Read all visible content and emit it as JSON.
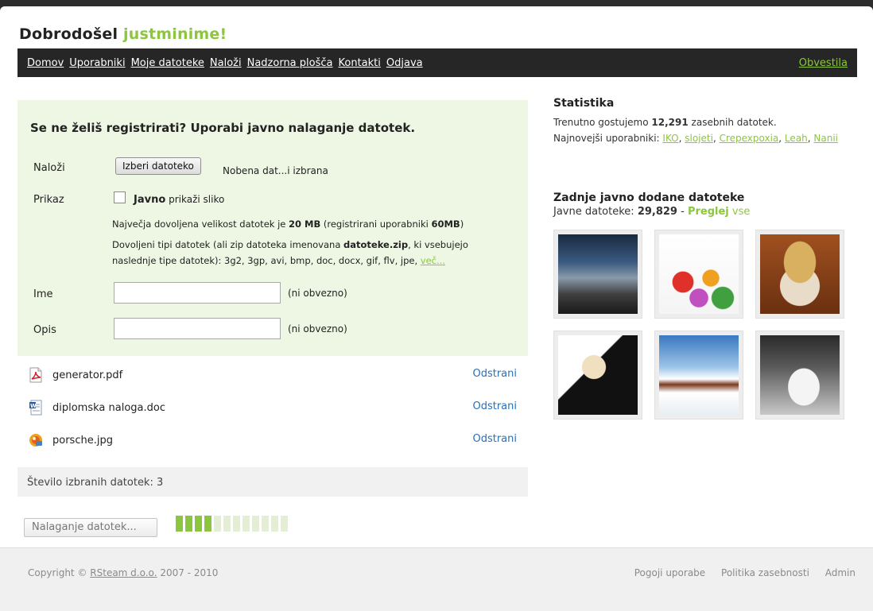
{
  "header": {
    "greeting": "Dobrodošel",
    "username": "justminime!"
  },
  "nav": {
    "items": [
      "Domov",
      "Uporabniki",
      "Moje datoteke",
      "Naloži",
      "Nadzorna plošča",
      "Kontakti",
      "Odjava"
    ],
    "right": "Obvestila"
  },
  "upload": {
    "heading": "Se ne želiš registrirati? Uporabi javno nalaganje datotek.",
    "upload_label": "Naloži",
    "choose_button": "Izberi datoteko",
    "no_file": "Nobena dat...i izbrana",
    "display_label": "Prikaz",
    "checkbox_bold": "Javno",
    "checkbox_text": "prikaži sliko",
    "max_size_prefix": "Največja dovoljena velikost datotek je",
    "max_size": "20 MB",
    "max_size_mid": "(registrirani uporabniki",
    "max_size_reg": "60MB",
    "max_size_end": ")",
    "types_prefix": "Dovoljeni tipi datotek (ali zip datoteka imenovana",
    "zip_name": "datoteke.zip",
    "types_mid": ", ki vsebujejo",
    "types_line2": "naslednje tipe datotek): 3g2, 3gp, avi, bmp, doc, docx, gif, flv, jpe,",
    "more_link": "več...",
    "name_label": "Ime",
    "desc_label": "Opis",
    "optional": "(ni obvezno)"
  },
  "files": [
    {
      "name": "generator.pdf",
      "icon": "pdf-icon",
      "remove": "Odstrani"
    },
    {
      "name": "diplomska naloga.doc",
      "icon": "word-doc-icon",
      "remove": "Odstrani"
    },
    {
      "name": "porsche.jpg",
      "icon": "image-file-icon",
      "remove": "Odstrani"
    }
  ],
  "selected_count_text": "Število izbranih datotek: 3",
  "upload_button": "Nalaganje datotek...",
  "progress": {
    "segments": 12,
    "filled": 4
  },
  "stats": {
    "title": "Statistika",
    "line1_prefix": "Trenutno gostujemo",
    "line1_count": "12,291",
    "line1_suffix": "zasebnih datotek.",
    "users_prefix": "Najnovejši uporabniki:",
    "users": [
      "IKO",
      "slojeti",
      "Crepexpoxia",
      "Leah",
      "Nanii"
    ]
  },
  "recent": {
    "title": "Zadnje javno dodane datoteke",
    "count_prefix": "Javne datoteke:",
    "count": "29,829",
    "dash": "-",
    "view": "Preglej",
    "all": "vse"
  },
  "thumbnails": [
    "car-photo-thumbnail",
    "flowers-thumbnail",
    "kitten-thumbnail",
    "woman-portrait-thumbnail",
    "snowy-cabin-thumbnail",
    "white-car-snow-thumbnail"
  ],
  "footer": {
    "copyright_prefix": "Copyright ©",
    "company": "RSteam d.o.o.",
    "years": "2007 - 2010",
    "links": [
      "Pogoji uporabe",
      "Politika zasebnosti",
      "Admin"
    ]
  },
  "colors": {
    "accent": "#8cc63f",
    "navbar": "#262626",
    "upload_bg": "#eef7e3",
    "link": "#2a6fb8"
  }
}
